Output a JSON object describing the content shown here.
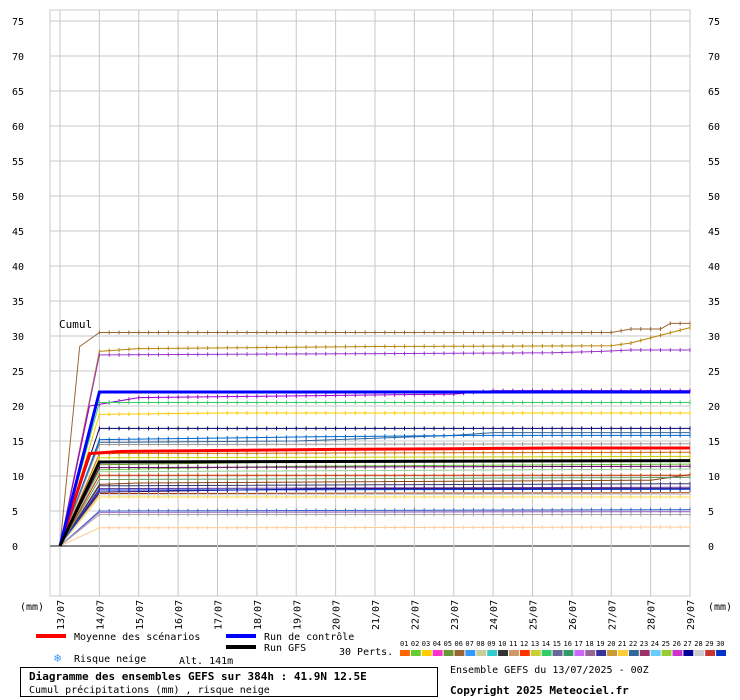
{
  "chart_data": {
    "type": "line",
    "title": "Diagramme des ensembles GEFS sur 384h : 41.9N 12.5E",
    "subtitle": "Cumul précipitations (mm) , risque neige",
    "ylabel": "(mm)",
    "ylim": [
      -8,
      75
    ],
    "yticks": [
      0,
      5,
      10,
      15,
      20,
      25,
      30,
      35,
      40,
      45,
      50,
      55,
      60,
      65,
      70,
      75
    ],
    "x_start_label": "13/07",
    "x_days": [
      "14/07",
      "15/07",
      "16/07",
      "17/07",
      "18/07",
      "19/07",
      "20/07",
      "21/07",
      "22/07",
      "23/07",
      "24/07",
      "25/07",
      "26/07",
      "27/07",
      "28/07",
      "29/07"
    ],
    "x_hours_max": 384,
    "cumul_label": "Cumul",
    "alt_label": "Alt. 141m",
    "perturbations_label": "30 Perts.",
    "series": [
      {
        "id": "moyenne",
        "name": "Moyenne des scénarios",
        "color": "#ff0000",
        "width": 3,
        "points": [
          [
            0,
            0
          ],
          [
            18,
            13.2
          ],
          [
            36,
            13.5
          ],
          [
            120,
            13.7
          ],
          [
            168,
            13.8
          ],
          [
            240,
            13.9
          ],
          [
            300,
            14
          ],
          [
            384,
            14
          ]
        ]
      },
      {
        "id": "controle",
        "name": "Run de contrôle",
        "color": "#0000ff",
        "width": 3,
        "points": [
          [
            0,
            0
          ],
          [
            24,
            22
          ],
          [
            384,
            22
          ]
        ]
      },
      {
        "id": "gfs",
        "name": "Run GFS",
        "color": "#000000",
        "width": 3,
        "points": [
          [
            0,
            0
          ],
          [
            24,
            12
          ],
          [
            384,
            12.2
          ]
        ]
      },
      {
        "id": "p01",
        "color": "#996633",
        "width": 1,
        "points": [
          [
            0,
            0
          ],
          [
            12,
            28.5
          ],
          [
            24,
            30.5
          ],
          [
            336,
            30.5
          ],
          [
            348,
            31
          ],
          [
            366,
            31
          ],
          [
            372,
            31.8
          ],
          [
            384,
            31.8
          ]
        ]
      },
      {
        "id": "p02",
        "color": "#b8860b",
        "width": 1,
        "points": [
          [
            0,
            0
          ],
          [
            24,
            27.8
          ],
          [
            48,
            28.2
          ],
          [
            192,
            28.5
          ],
          [
            336,
            28.6
          ],
          [
            348,
            29
          ],
          [
            384,
            31.2
          ]
        ]
      },
      {
        "id": "p03",
        "color": "#9933cc",
        "width": 1,
        "points": [
          [
            0,
            0
          ],
          [
            24,
            27.3
          ],
          [
            300,
            27.6
          ],
          [
            330,
            27.8
          ],
          [
            348,
            28
          ],
          [
            384,
            28
          ]
        ]
      },
      {
        "id": "p04",
        "color": "#9900cc",
        "width": 1,
        "points": [
          [
            0,
            0
          ],
          [
            18,
            20
          ],
          [
            48,
            21.2
          ],
          [
            240,
            21.7
          ],
          [
            264,
            22.2
          ],
          [
            384,
            22.2
          ]
        ]
      },
      {
        "id": "p05",
        "color": "#33cc66",
        "width": 1,
        "points": [
          [
            0,
            0
          ],
          [
            24,
            20.5
          ],
          [
            384,
            20.5
          ]
        ]
      },
      {
        "id": "p06",
        "color": "#ffcc00",
        "width": 1,
        "points": [
          [
            0,
            0
          ],
          [
            24,
            18.8
          ],
          [
            96,
            19
          ],
          [
            384,
            19
          ]
        ]
      },
      {
        "id": "p07",
        "color": "#000066",
        "width": 1,
        "points": [
          [
            0,
            0
          ],
          [
            24,
            16.8
          ],
          [
            384,
            16.8
          ]
        ]
      },
      {
        "id": "p08",
        "color": "#336699",
        "width": 1,
        "points": [
          [
            0,
            0
          ],
          [
            24,
            14.8
          ],
          [
            144,
            15
          ],
          [
            240,
            15.8
          ],
          [
            264,
            16.2
          ],
          [
            384,
            16.2
          ]
        ]
      },
      {
        "id": "p09",
        "color": "#0066cc",
        "width": 1,
        "points": [
          [
            0,
            0
          ],
          [
            24,
            15.2
          ],
          [
            156,
            15.6
          ],
          [
            252,
            15.8
          ],
          [
            384,
            15.8
          ]
        ]
      },
      {
        "id": "p10",
        "color": "#999999",
        "width": 1,
        "points": [
          [
            0,
            0
          ],
          [
            24,
            14.5
          ],
          [
            384,
            14.6
          ]
        ]
      },
      {
        "id": "p11",
        "color": "#cc6600",
        "width": 1,
        "points": [
          [
            0,
            0
          ],
          [
            24,
            13.2
          ],
          [
            384,
            13.4
          ]
        ]
      },
      {
        "id": "p12",
        "color": "#cccc00",
        "width": 1,
        "points": [
          [
            0,
            0
          ],
          [
            24,
            12.6
          ],
          [
            384,
            12.8
          ]
        ]
      },
      {
        "id": "p13",
        "color": "#669933",
        "width": 1,
        "points": [
          [
            0,
            0
          ],
          [
            24,
            11.6
          ],
          [
            144,
            12
          ],
          [
            384,
            12.2
          ]
        ]
      },
      {
        "id": "p14",
        "color": "#66cc33",
        "width": 1,
        "points": [
          [
            0,
            0
          ],
          [
            24,
            10.9
          ],
          [
            144,
            11.4
          ],
          [
            384,
            11.7
          ]
        ]
      },
      {
        "id": "p15",
        "color": "#99cc99",
        "width": 1,
        "points": [
          [
            0,
            0
          ],
          [
            24,
            10.6
          ],
          [
            384,
            11
          ]
        ]
      },
      {
        "id": "p16",
        "color": "#8b4513",
        "width": 1,
        "points": [
          [
            0,
            0
          ],
          [
            24,
            8.8
          ],
          [
            48,
            9
          ],
          [
            360,
            9.4
          ],
          [
            384,
            10.2
          ]
        ]
      },
      {
        "id": "p17",
        "color": "#333366",
        "width": 1,
        "points": [
          [
            0,
            0
          ],
          [
            24,
            8.6
          ],
          [
            384,
            8.9
          ]
        ]
      },
      {
        "id": "p18",
        "color": "#663399",
        "width": 1,
        "points": [
          [
            0,
            0
          ],
          [
            24,
            8.2
          ],
          [
            384,
            8.4
          ]
        ]
      },
      {
        "id": "p19",
        "color": "#330066",
        "width": 1,
        "points": [
          [
            0,
            0
          ],
          [
            24,
            7.7
          ],
          [
            168,
            8.2
          ],
          [
            384,
            8.2
          ]
        ]
      },
      {
        "id": "p20",
        "color": "#993300",
        "width": 1,
        "points": [
          [
            0,
            0
          ],
          [
            24,
            7.5
          ],
          [
            384,
            7.6
          ]
        ]
      },
      {
        "id": "p21",
        "color": "#ffdd44",
        "width": 1,
        "points": [
          [
            0,
            0
          ],
          [
            24,
            7
          ],
          [
            384,
            7
          ]
        ]
      },
      {
        "id": "p22",
        "color": "#3366cc",
        "width": 1,
        "points": [
          [
            0,
            0
          ],
          [
            24,
            5
          ],
          [
            384,
            5.2
          ]
        ]
      },
      {
        "id": "p23",
        "color": "#9966cc",
        "width": 1,
        "points": [
          [
            0,
            0
          ],
          [
            24,
            4.8
          ],
          [
            384,
            4.9
          ]
        ]
      },
      {
        "id": "p24",
        "color": "#aaaaaa",
        "width": 1,
        "points": [
          [
            0,
            0
          ],
          [
            24,
            4.5
          ],
          [
            384,
            4.5
          ]
        ]
      },
      {
        "id": "p25",
        "color": "#ffcc99",
        "width": 1,
        "points": [
          [
            0,
            0
          ],
          [
            24,
            2.6
          ],
          [
            384,
            2.7
          ]
        ]
      },
      {
        "id": "p26",
        "color": "#cc3300",
        "width": 1,
        "points": [
          [
            0,
            0
          ],
          [
            24,
            10.1
          ],
          [
            384,
            10.1
          ]
        ]
      },
      {
        "id": "p27",
        "color": "#660066",
        "width": 1,
        "points": [
          [
            0,
            0
          ],
          [
            24,
            11.2
          ],
          [
            384,
            11.4
          ]
        ]
      },
      {
        "id": "p28",
        "color": "#669966",
        "width": 1,
        "points": [
          [
            0,
            0
          ],
          [
            24,
            9.5
          ],
          [
            384,
            9.8
          ]
        ]
      },
      {
        "id": "p29",
        "color": "#0033cc",
        "width": 1,
        "points": [
          [
            0,
            0
          ],
          [
            24,
            8
          ],
          [
            384,
            8.1
          ]
        ]
      },
      {
        "id": "p30",
        "color": "#cccccc",
        "width": 1,
        "points": [
          [
            0,
            0
          ],
          [
            24,
            7.3
          ],
          [
            384,
            7.4
          ]
        ]
      }
    ],
    "perturbation_labels": [
      "01",
      "02",
      "03",
      "04",
      "05",
      "06",
      "07",
      "08",
      "09",
      "10",
      "11",
      "12",
      "13",
      "14",
      "15",
      "16",
      "17",
      "18",
      "19",
      "20",
      "21",
      "22",
      "23",
      "24",
      "25",
      "26",
      "27",
      "28",
      "29",
      "30"
    ],
    "perturbation_colors": [
      "#ff6600",
      "#66cc33",
      "#ffcc00",
      "#ff33cc",
      "#669933",
      "#996633",
      "#3399ff",
      "#cccc99",
      "#33cccc",
      "#333333",
      "#cc9966",
      "#ff3300",
      "#cccc33",
      "#33cc66",
      "#666699",
      "#339966",
      "#cc66ff",
      "#996699",
      "#333399",
      "#cc9933",
      "#ffcc33",
      "#336699",
      "#993366",
      "#66ccff",
      "#99cc33",
      "#cc33cc",
      "#000099",
      "#cccccc",
      "#cc3333",
      "#0033cc"
    ],
    "legend": {
      "moyenne": "Moyenne des scénarios",
      "controle": "Run de contrôle",
      "gfs": "Run GFS",
      "neige": "Risque neige"
    }
  },
  "footer": {
    "run_info": "Ensemble GEFS du 13/07/2025 - 00Z",
    "copyright": "Copyright 2025 Meteociel.fr"
  }
}
